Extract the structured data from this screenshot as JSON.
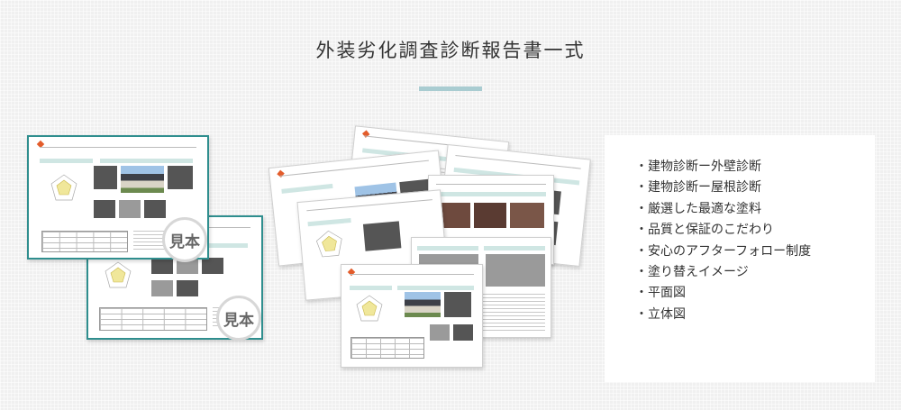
{
  "heading": "外装劣化調査診断報告書一式",
  "sample_stamps": [
    "見本",
    "見本"
  ],
  "features": [
    "建物診断ー外壁診断",
    "建物診断ー屋根診断",
    "厳選した最適な塗料",
    "品質と保証のこだわり",
    "安心のアフターフォロー制度",
    "塗り替えイメージ",
    "平面図",
    "立体図"
  ],
  "bullet": "・",
  "colors": {
    "accent_rule": "#a9ccd1",
    "teal_border": "#2f8e8e",
    "logo": "#e35c2b"
  }
}
